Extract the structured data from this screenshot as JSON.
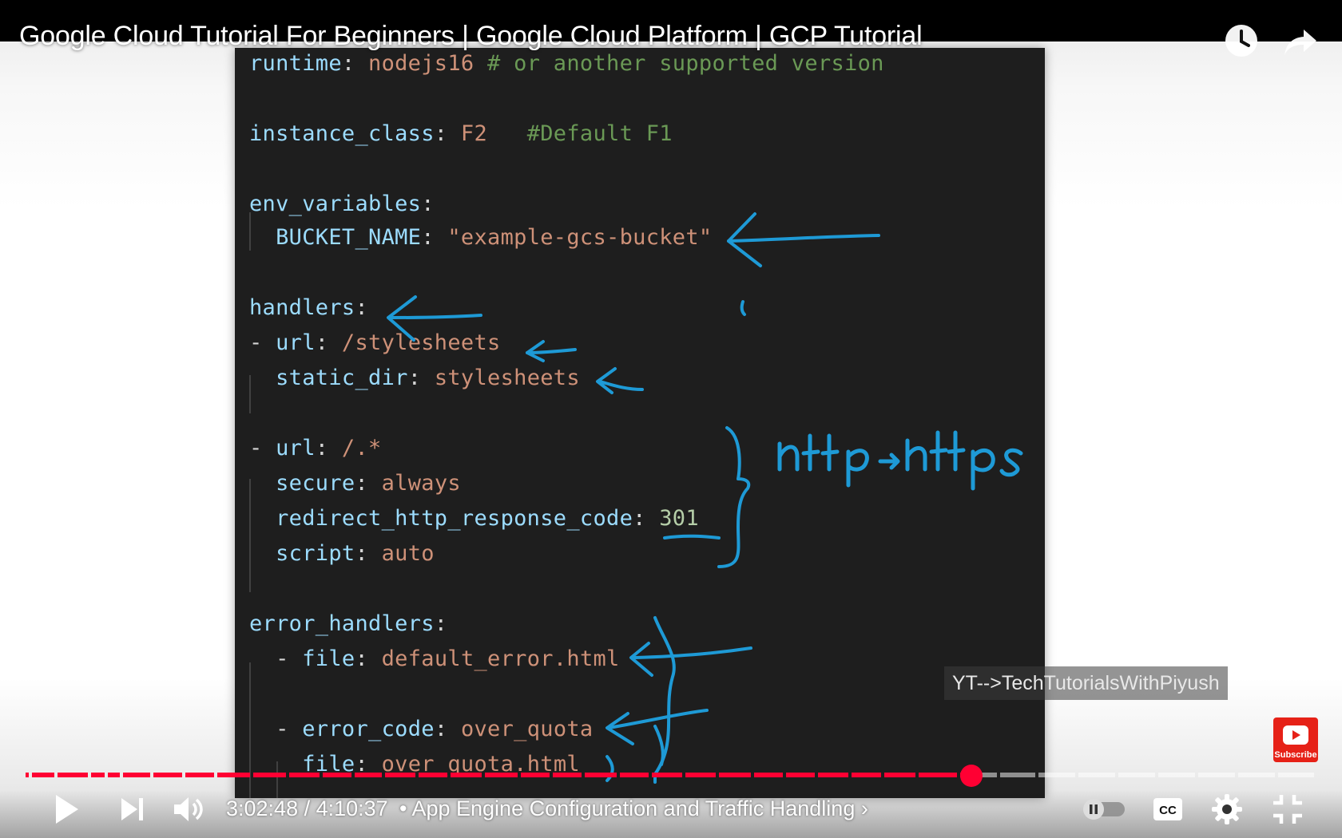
{
  "video": {
    "title": "Google Cloud Tutorial For Beginners | Google Cloud Platform | GCP Tutorial",
    "watermark": "YT-->TechTutorialsWithPiyush",
    "subscribe_label": "Subscribe",
    "progress_fraction": 0.7257
  },
  "top_icons": [
    "watch-later-icon",
    "share-icon"
  ],
  "code": {
    "lines": [
      {
        "key": "runtime",
        "sep": ": ",
        "value": "nodejs16",
        "comment": " # or another supported version"
      },
      {
        "key": "instance_class",
        "sep": ": ",
        "value": "F2",
        "comment": "   #Default F1"
      },
      {
        "key": "env_variables",
        "sep": ":",
        "value": "",
        "comment": ""
      },
      {
        "indent": "  ",
        "key": "BUCKET_NAME",
        "sep": ": ",
        "value": "\"example-gcs-bucket\"",
        "comment": ""
      },
      {
        "key": "handlers",
        "sep": ":",
        "value": "",
        "comment": ""
      },
      {
        "dash": "- ",
        "key": "url",
        "sep": ": ",
        "value": "/stylesheets",
        "comment": ""
      },
      {
        "indent": "  ",
        "key": "static_dir",
        "sep": ": ",
        "value": "stylesheets",
        "comment": ""
      },
      {
        "dash": "- ",
        "key": "url",
        "sep": ": ",
        "value": "/.*",
        "comment": ""
      },
      {
        "indent": "  ",
        "key": "secure",
        "sep": ": ",
        "value": "always",
        "comment": ""
      },
      {
        "indent": "  ",
        "key": "redirect_http_response_code",
        "sep": ": ",
        "value": "301",
        "comment": ""
      },
      {
        "indent": "  ",
        "key": "script",
        "sep": ": ",
        "value": "auto",
        "comment": ""
      },
      {
        "key": "error_handlers",
        "sep": ":",
        "value": "",
        "comment": ""
      },
      {
        "indent": "  ",
        "dash": "- ",
        "key": "file",
        "sep": ": ",
        "value": "default_error.html",
        "comment": ""
      },
      {
        "indent": "  ",
        "dash": "- ",
        "key": "error_code",
        "sep": ": ",
        "value": "over_quota",
        "comment": ""
      },
      {
        "indent": "    ",
        "key": "file",
        "sep": ": ",
        "value": "over_quota.html",
        "comment": ""
      }
    ],
    "annotation_text": "http→https"
  },
  "controls": {
    "current_time": "3:02:48",
    "duration": "4:10:37",
    "separator": " / ",
    "chapter": "• App Engine Configuration and Traffic Handling ›",
    "icons_left": [
      "play-icon",
      "next-icon",
      "volume-icon"
    ],
    "icons_right": [
      "autoplay-toggle-icon",
      "captions-icon",
      "settings-icon",
      "exit-fullscreen-icon"
    ]
  },
  "colors": {
    "progress_played": "#ff0033",
    "progress_buffered": "rgba(255,255,255,0.5)",
    "code_bg": "#1e1e1e",
    "key": "#9cdcfe",
    "string": "#ce9178",
    "comment": "#6a9955",
    "number": "#b5cea8",
    "pen": "#1e9ad6"
  }
}
